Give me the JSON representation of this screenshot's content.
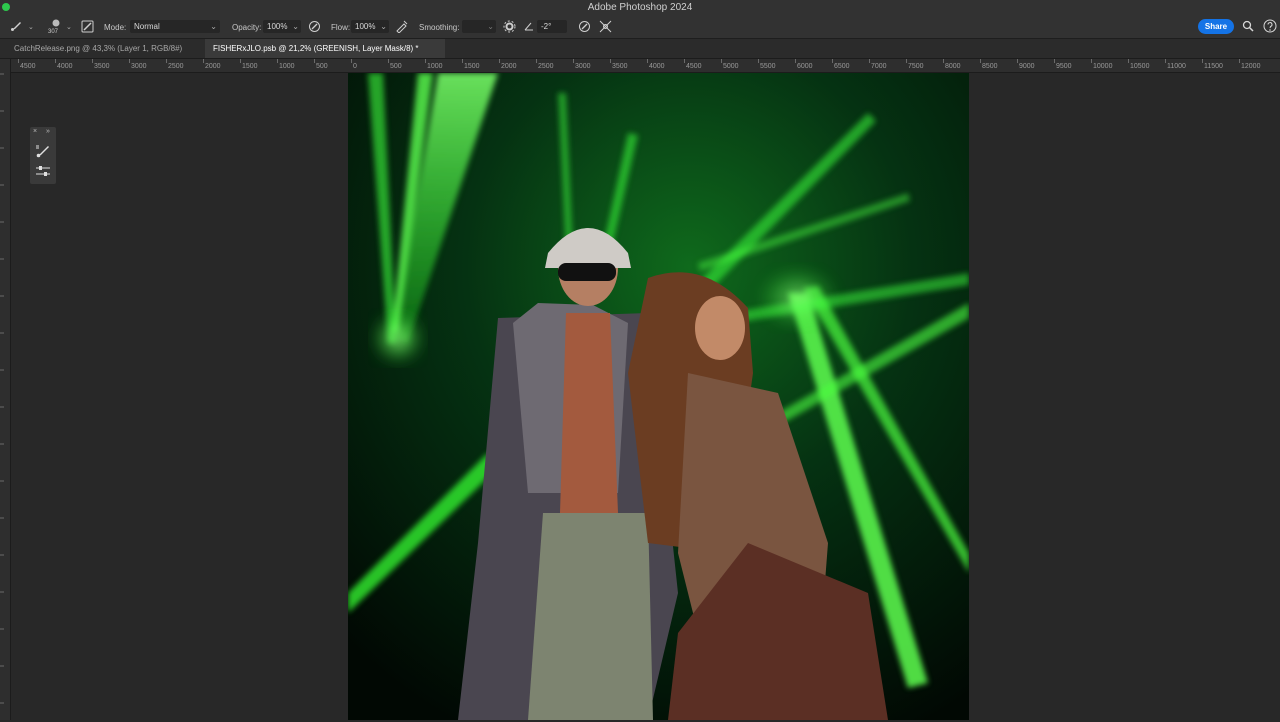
{
  "app": {
    "title": "Adobe Photoshop 2024"
  },
  "options_bar": {
    "brush_size": "307",
    "mode_label": "Mode:",
    "mode_value": "Normal",
    "opacity_label": "Opacity:",
    "opacity_value": "100%",
    "flow_label": "Flow:",
    "flow_value": "100%",
    "smoothing_label": "Smoothing:",
    "smoothing_value": "",
    "angle_value": "-2°",
    "share_label": "Share"
  },
  "tabs": [
    {
      "label": "CatchRelease.png @ 43,3% (Layer 1, RGB/8#)",
      "active": false
    },
    {
      "label": "FISHERxJLO.psb @ 21,2% (GREENISH, Layer Mask/8) *",
      "active": true
    }
  ],
  "ruler": {
    "h_labels": [
      "4500",
      "4000",
      "3500",
      "3000",
      "2500",
      "2000",
      "1500",
      "1000",
      "500",
      "0",
      "500",
      "1000",
      "1500",
      "2000",
      "2500",
      "3000",
      "3500",
      "4000",
      "4500",
      "5000",
      "5500",
      "6000",
      "6500",
      "7000",
      "7500",
      "8000",
      "8500",
      "9000",
      "9500",
      "10000",
      "10500",
      "11000",
      "11500",
      "12000"
    ]
  },
  "colors": {
    "accent": "#1473e6",
    "laser_green": "#39ff3a",
    "workspace": "#282828"
  }
}
